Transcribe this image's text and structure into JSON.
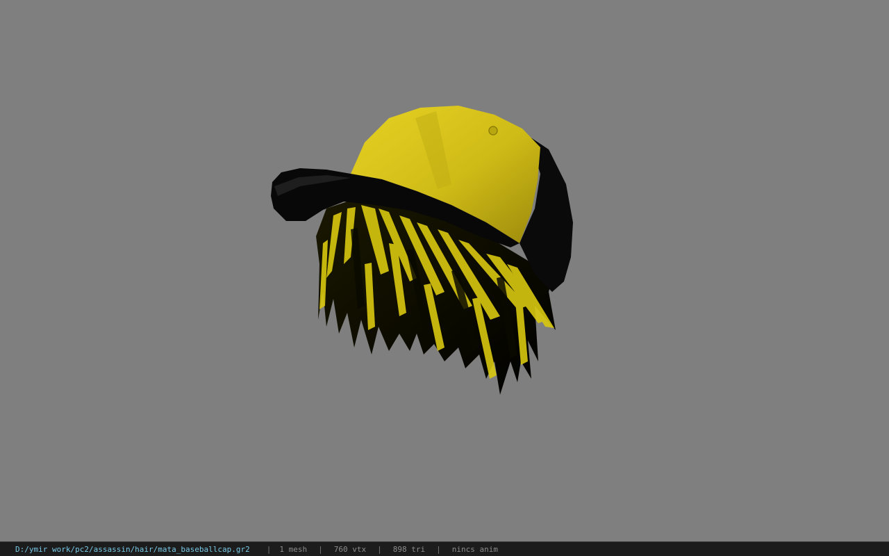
{
  "viewer": {
    "background_color": "#7f7f7f",
    "model": {
      "icon": "baseball-cap-hair-model",
      "cap_color": "#d8c41a",
      "brim_color": "#0a0a0a",
      "hair_colors": [
        "#0b0b00",
        "#e0d010"
      ]
    }
  },
  "status_bar": {
    "file_path": "D:/ymir work/pc2/assassin/hair/mata_baseballcap.gr2",
    "separator": "|",
    "mesh_count": "1 mesh",
    "vertex_count": "760 vtx",
    "triangle_count": "898 tri",
    "animation": "nincs anim"
  }
}
